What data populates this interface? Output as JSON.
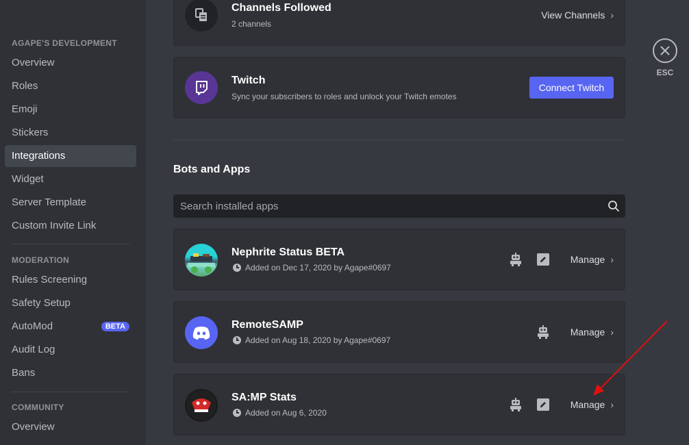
{
  "sidebar": {
    "sections": [
      {
        "header": "Agape's Development",
        "items": [
          "Overview",
          "Roles",
          "Emoji",
          "Stickers",
          "Integrations",
          "Widget",
          "Server Template",
          "Custom Invite Link"
        ]
      },
      {
        "header": "Moderation",
        "items": [
          "Rules Screening",
          "Safety Setup",
          "AutoMod",
          "Audit Log",
          "Bans"
        ]
      },
      {
        "header": "Community",
        "items": [
          "Overview"
        ]
      }
    ],
    "active_item": "Integrations",
    "automod_badge": "BETA"
  },
  "channels_followed": {
    "title": "Channels Followed",
    "subtitle": "2 channels",
    "action": "View Channels"
  },
  "twitch": {
    "title": "Twitch",
    "subtitle": "Sync your subscribers to roles and unlock your Twitch emotes",
    "button": "Connect Twitch",
    "brand_color": "#593695"
  },
  "bots_section": {
    "title": "Bots and Apps",
    "search_placeholder": "Search installed apps"
  },
  "apps": [
    {
      "name": "Nephrite Status BETA",
      "added": "Added on Dec 17, 2020 by Agape#0697",
      "manage": "Manage",
      "has_edit": true
    },
    {
      "name": "RemoteSAMP",
      "added": "Added on Aug 18, 2020 by Agape#0697",
      "manage": "Manage",
      "has_edit": false
    },
    {
      "name": "SA:MP Stats",
      "added": "Added on Aug 6, 2020",
      "manage": "Manage",
      "has_edit": true
    }
  ],
  "close": {
    "label": "ESC"
  },
  "colors": {
    "blurple": "#5865f2",
    "annotation_arrow": "#e01010"
  }
}
